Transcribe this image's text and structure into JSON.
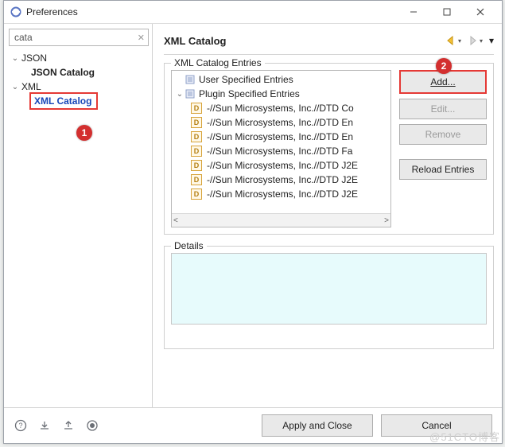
{
  "window": {
    "title": "Preferences"
  },
  "left": {
    "search_value": "cata",
    "tree": {
      "json": {
        "label": "JSON",
        "child_label": "JSON Catalog"
      },
      "xml": {
        "label": "XML",
        "child_label": "XML Catalog"
      }
    }
  },
  "right": {
    "title": "XML Catalog",
    "entries_group_label": "XML Catalog Entries",
    "entries": {
      "user_label": "User Specified Entries",
      "plugin_label": "Plugin Specified Entries",
      "plugin_items": [
        "-//Sun Microsystems, Inc.//DTD Co",
        "-//Sun Microsystems, Inc.//DTD En",
        "-//Sun Microsystems, Inc.//DTD En",
        "-//Sun Microsystems, Inc.//DTD Fa",
        "-//Sun Microsystems, Inc.//DTD J2E",
        "-//Sun Microsystems, Inc.//DTD J2E",
        "-//Sun Microsystems, Inc.//DTD J2E"
      ]
    },
    "buttons": {
      "add": "Add...",
      "edit": "Edit...",
      "remove": "Remove",
      "reload": "Reload Entries"
    },
    "details_label": "Details"
  },
  "bottom": {
    "apply": "Apply and Close",
    "cancel": "Cancel"
  },
  "annotations": {
    "badge1": "1",
    "badge2": "2"
  },
  "watermark": "@51CTO博客"
}
